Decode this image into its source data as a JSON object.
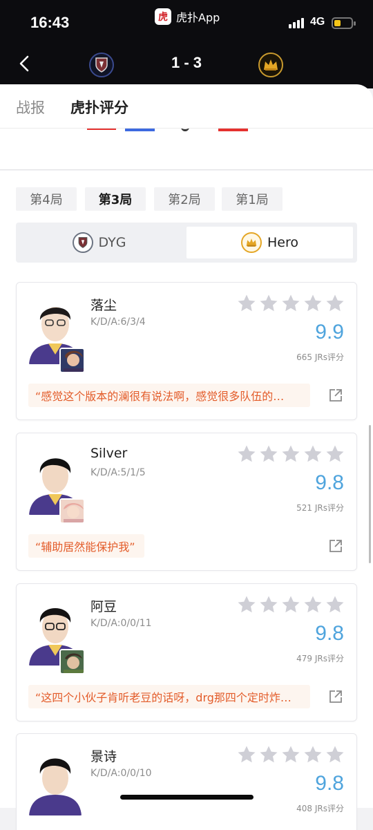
{
  "status_bar": {
    "time": "16:43",
    "app_label": "虎扑App",
    "app_logo_char": "虎",
    "network": "4G",
    "battery_color": "#f5c518"
  },
  "match": {
    "score": "1 - 3",
    "team_left_icon": "dyg-logo",
    "team_right_icon": "hero-logo"
  },
  "tabs": [
    {
      "label": "战报"
    },
    {
      "label": "虎扑评分"
    }
  ],
  "games": [
    {
      "label": "第4局"
    },
    {
      "label": "第3局"
    },
    {
      "label": "第2局"
    },
    {
      "label": "第1局"
    }
  ],
  "active_game": "第3局",
  "teams": [
    {
      "name": "DYG"
    },
    {
      "name": "Hero"
    }
  ],
  "active_team": "Hero",
  "colors": {
    "score_blue": "#4fa4dd",
    "quote_orange": "#e35c2a",
    "quote_bg": "#fdf5ef"
  },
  "players": [
    {
      "name": "落尘",
      "kda": "K/D/A:6/3/4",
      "score": "9.9",
      "ratings": "665 JRs评分",
      "quote": "“感觉这个版本的澜很有说法啊，感觉很多队伍的…",
      "stars": 5
    },
    {
      "name": "Silver",
      "kda": "K/D/A:5/1/5",
      "score": "9.8",
      "ratings": "521 JRs评分",
      "quote": "“辅助居然能保护我”",
      "stars": 5
    },
    {
      "name": "阿豆",
      "kda": "K/D/A:0/0/11",
      "score": "9.8",
      "ratings": "479 JRs评分",
      "quote": "“这四个小伙子肯听老豆的话呀，drg那四个定时炸…",
      "stars": 5
    },
    {
      "name": "景诗",
      "kda": "K/D/A:0/0/10",
      "score": "9.8",
      "ratings": "408 JRs评分",
      "quote": "",
      "stars": 5
    }
  ]
}
